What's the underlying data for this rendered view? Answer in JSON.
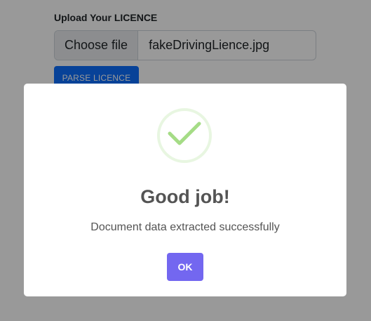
{
  "upload": {
    "label": "Upload Your LICENCE",
    "choose_file_label": "Choose file",
    "file_name": "fakeDrivingLience.jpg",
    "parse_button_label": "PARSE LICENCE"
  },
  "modal": {
    "icon": "checkmark-success-icon",
    "title": "Good job!",
    "text": "Document data extracted successfully",
    "ok_label": "OK"
  },
  "colors": {
    "overlay": "#989898",
    "accent": "#7367f0",
    "primary": "#0d6efd",
    "success": "#a5dc86"
  }
}
